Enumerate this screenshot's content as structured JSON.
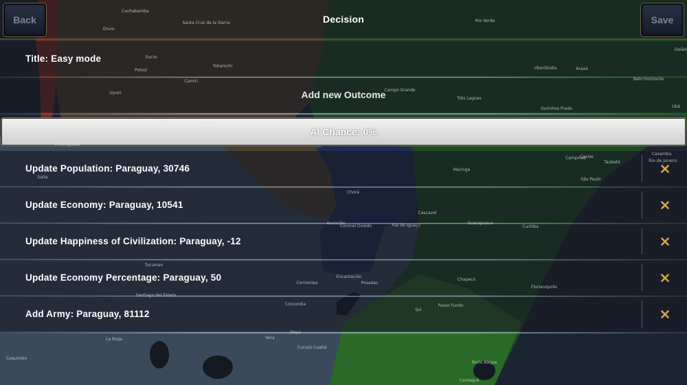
{
  "header": {
    "title": "Decision",
    "back_label": "Back",
    "save_label": "Save"
  },
  "decision": {
    "title_line": "Title: Easy mode",
    "add_outcome_label": "Add new Outcome",
    "ai_chance_label": "AI Chance: 0%"
  },
  "outcomes": [
    {
      "label": "Update Population: Paraguay, 30746"
    },
    {
      "label": "Update Economy: Paraguay, 10541"
    },
    {
      "label": "Update Happiness of Civilization: Paraguay, -12"
    },
    {
      "label": "Update Economy Percentage: Paraguay, 50"
    },
    {
      "label": "Add Army: Paraguay, 81112"
    }
  ],
  "map_labels": [
    "Cochabamba",
    "Santa Cruz de la Sierra",
    "Oruro",
    "Sucre",
    "Potosí",
    "Tobarochi",
    "Camiri",
    "Uyuni",
    "Tarija",
    "Calama",
    "Antofagasta",
    "Tartagal",
    "Salta",
    "Tucuman",
    "Santiago del Estero",
    "La Rioja",
    "Coquimbo",
    "Vera",
    "Goya",
    "Curuzú Cuatiá",
    "Concordia",
    "Corrientes",
    "Encarnación",
    "Posadas",
    "Asunción",
    "Coronel Oviedo",
    "Foz do Iguaçu",
    "Chorá",
    "Cascavel",
    "Guarapuava",
    "Curitiba",
    "Chapecó",
    "Passo Fundo",
    "Ijuí",
    "Porto Alegre",
    "Florianópolis",
    "Caxias",
    "São Paulo",
    "Campinas",
    "Taubaté",
    "Rio de Janeiro",
    "Campo Grande",
    "Três Lagoas",
    "Uberlândia",
    "Araxá",
    "Belo Horizonte",
    "Rio Verde",
    "Maringá",
    "Ourinhos Prado",
    "Ubá",
    "Presidente Prudente",
    "Goiânia",
    "Caxambu",
    "Camaquã"
  ]
}
